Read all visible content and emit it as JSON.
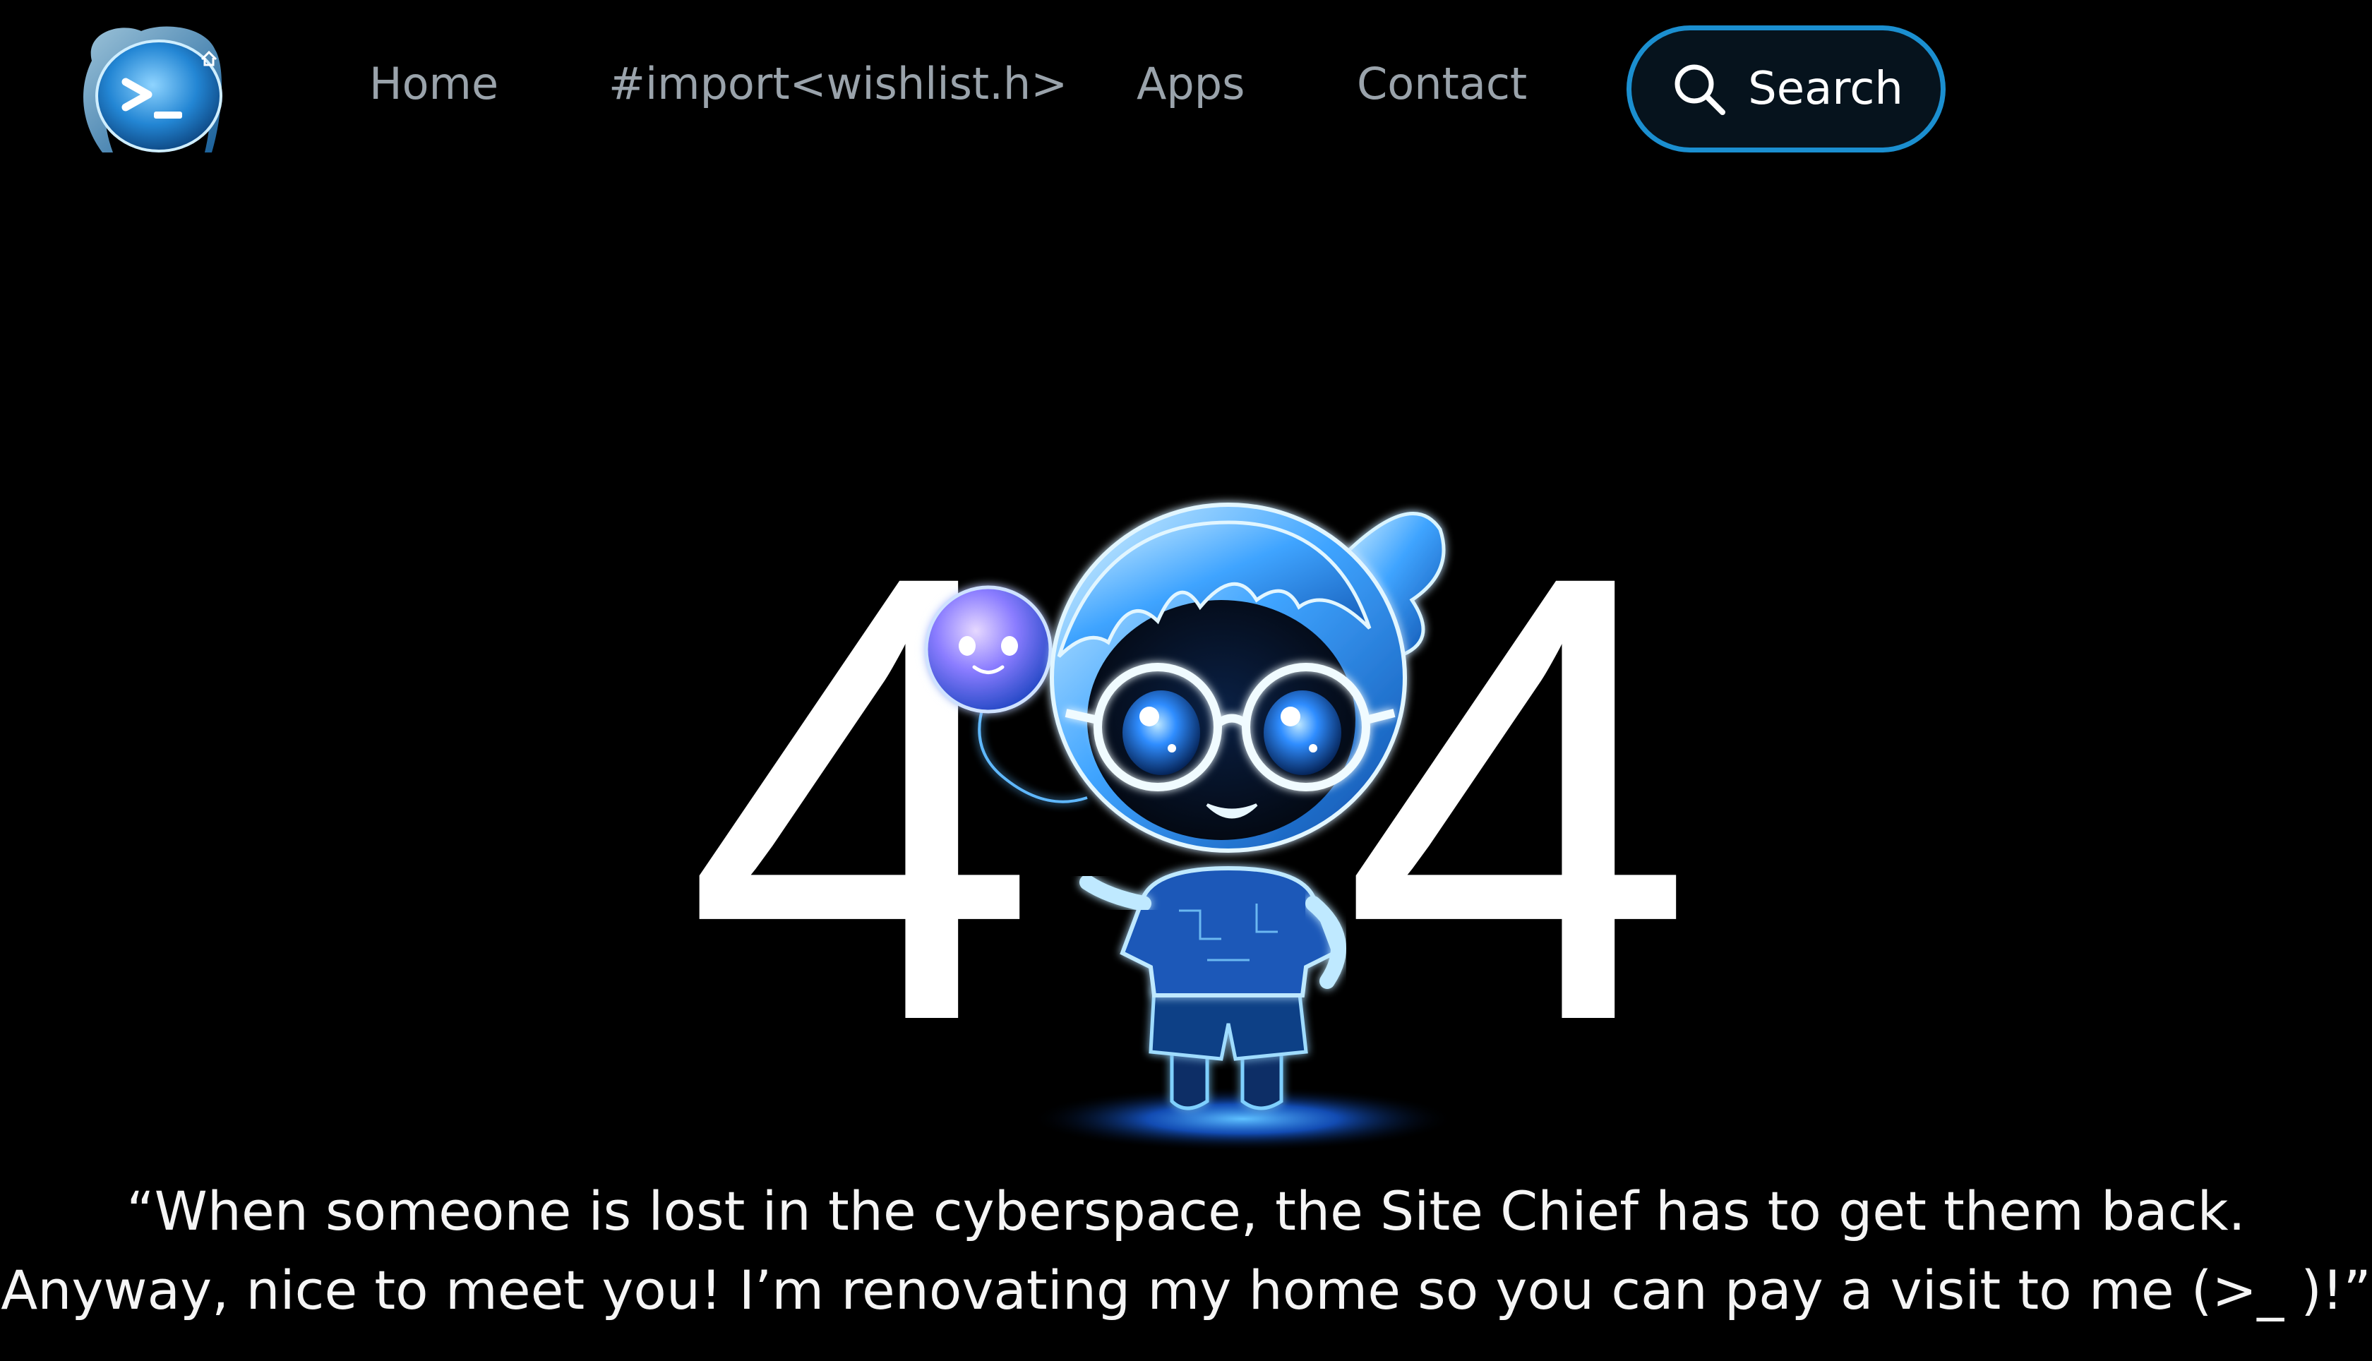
{
  "nav": {
    "logo_icon": "terminal-heart-logo",
    "links": [
      {
        "label": "Home"
      },
      {
        "label": "#import<wishlist.h>"
      },
      {
        "label": "Apps"
      },
      {
        "label": "Contact"
      }
    ],
    "search": {
      "label": "Search",
      "icon": "search-icon"
    }
  },
  "hero": {
    "digit_left": "4",
    "digit_right": "4",
    "mascot_icon": "glowing-girl-mascot"
  },
  "quote": {
    "line1": "“When someone is lost in the cyberspace, the Site Chief has to get them back.",
    "line2": "Anyway, nice to meet you! I’m renovating my home so you can pay a visit to me (>_ )!”"
  },
  "colors": {
    "background": "#000000",
    "accent": "#1b8fd0",
    "nav_text": "#9aa3ab",
    "glow": "#3aa0ff"
  }
}
